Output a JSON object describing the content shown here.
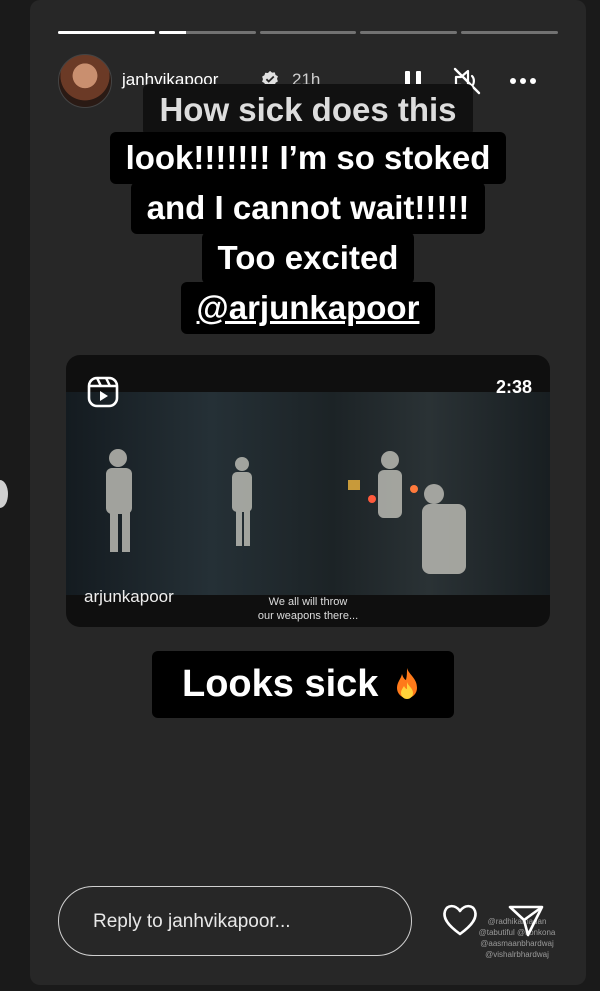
{
  "story": {
    "progress": [
      1.0,
      0.28,
      0,
      0,
      0
    ],
    "username": "janhvikapoor",
    "time_ago": "21h",
    "caption_lines": [
      "How sick does this",
      "look!!!!!!! I’m so stoked",
      "and I cannot wait!!!!!",
      "Too excited"
    ],
    "mention": "@arjunkapoor",
    "reel": {
      "duration": "2:38",
      "author": "arjunkapoor",
      "subtitle_line1": "We all will throw",
      "subtitle_line2": "our weapons there..."
    },
    "bottom_caption": "Looks sick",
    "reply_placeholder": "Reply to janhvikapoor...",
    "tags": [
      "@radhikamadan",
      "@tabutiful @konkona",
      "@aasmaanbhardwaj",
      "@vishalrbhardwaj"
    ]
  },
  "colors": {
    "background": "#1a1a1a",
    "card": "#272727",
    "caption_bg": "#000000"
  },
  "icons": [
    "pause-icon",
    "mute-icon",
    "more-icon",
    "reels-icon",
    "fire-emoji",
    "heart-icon",
    "share-icon",
    "verified-icon"
  ]
}
